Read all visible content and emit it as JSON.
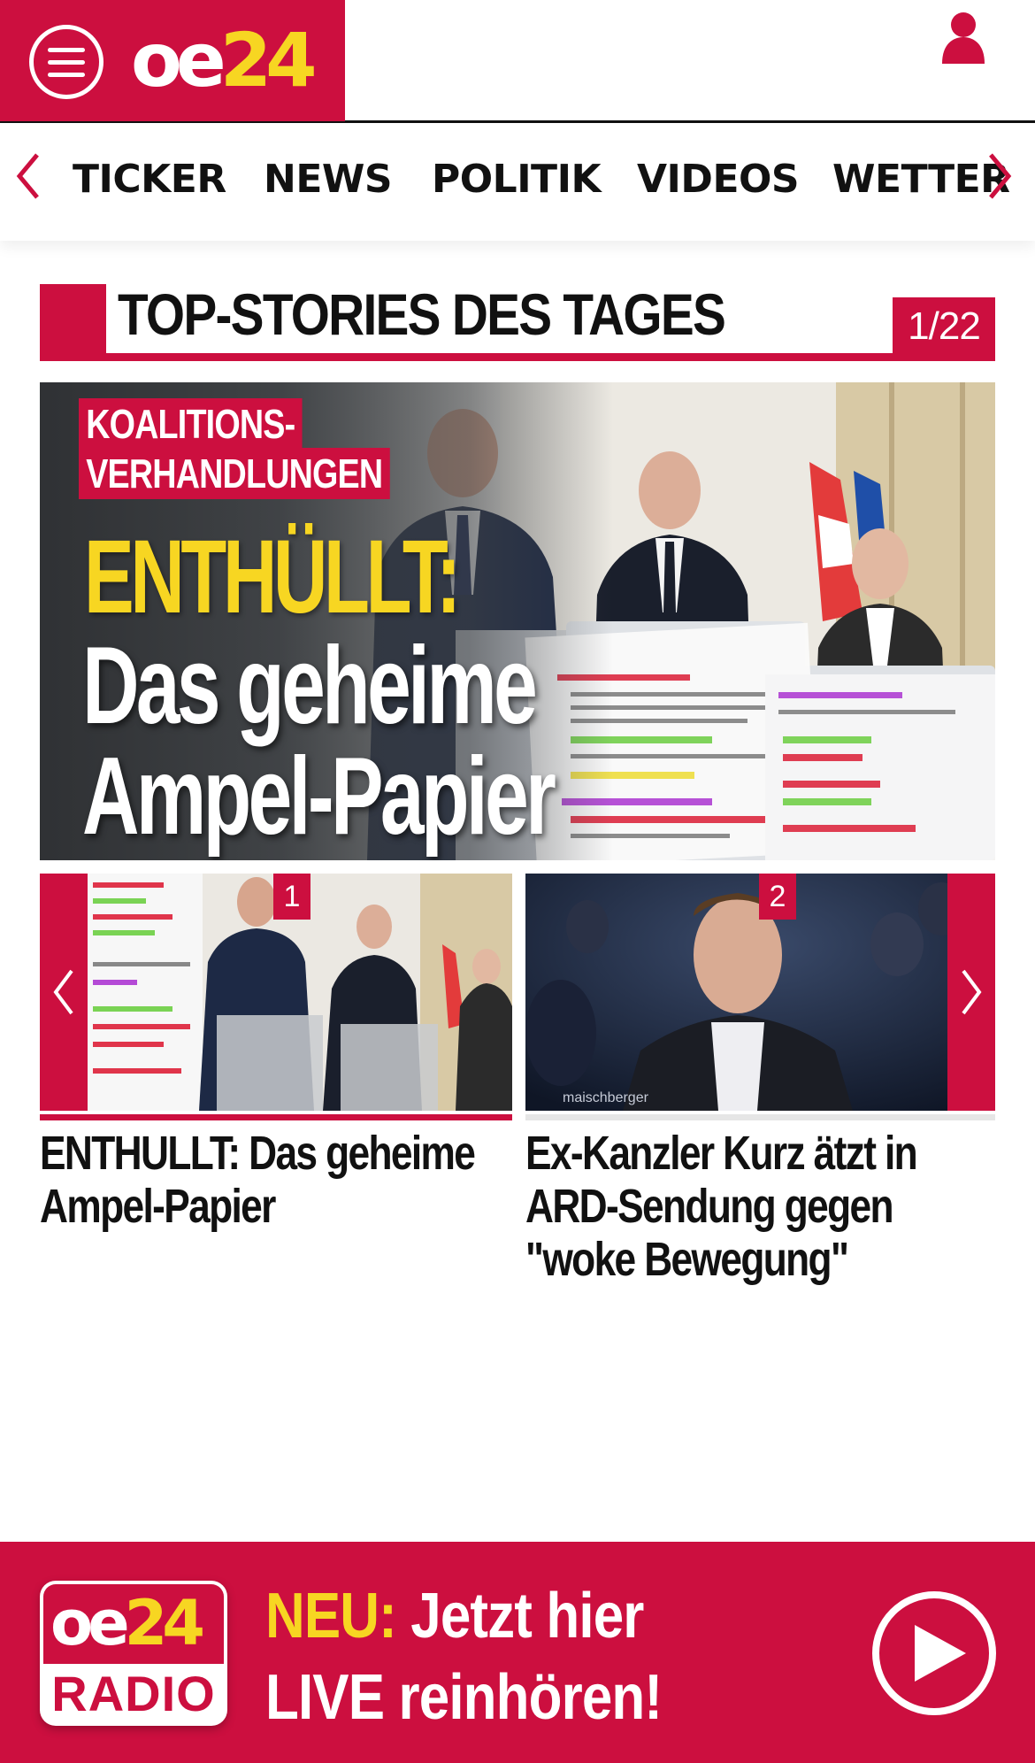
{
  "header": {
    "logo_primary": "oe",
    "logo_accent": "24",
    "menu_icon": "hamburger-menu-icon",
    "user_icon": "user-icon"
  },
  "nav": {
    "items": [
      {
        "label": "TICKER"
      },
      {
        "label": "NEWS"
      },
      {
        "label": "POLITIK"
      },
      {
        "label": "VIDEOS"
      },
      {
        "label": "WETTER"
      }
    ],
    "prev_icon": "chevron-left-icon",
    "next_icon": "chevron-right-icon"
  },
  "top_stories": {
    "title": "TOP-STORIES DES TAGES",
    "counter": "1/22"
  },
  "hero": {
    "kicker_line1": "KOALITIONS-",
    "kicker_line2": "VERHANDLUNGEN",
    "headline_highlight": "ENTHÜLLT:",
    "headline_line1": "Das geheime",
    "headline_line2": "Ampel-Papier"
  },
  "carousel": {
    "slides": [
      {
        "number": "1",
        "caption": "ENTHULLT: Das geheime Ampel-Papier",
        "active": true
      },
      {
        "number": "2",
        "caption": "Ex-Kanzler Kurz ätzt in ARD-Sendung gegen \"woke Bewegung\"",
        "active": false,
        "watermark": "maischberger"
      }
    ]
  },
  "radio_banner": {
    "logo_primary": "oe",
    "logo_accent": "24",
    "logo_sub": "RADIO",
    "neu_label": "NEU:",
    "line1_rest": "Jetzt hier",
    "line2": "LIVE reinhören!"
  },
  "colors": {
    "brand_red": "#cc0f3f",
    "brand_yellow": "#f7d622"
  }
}
